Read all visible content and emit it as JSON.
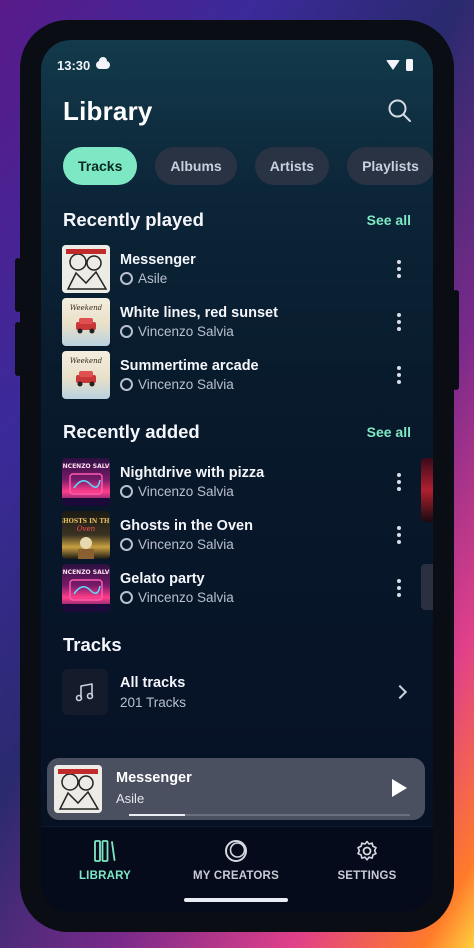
{
  "status_bar": {
    "time": "13:30"
  },
  "header": {
    "title": "Library"
  },
  "chips": [
    {
      "label": "Tracks",
      "active": true
    },
    {
      "label": "Albums"
    },
    {
      "label": "Artists"
    },
    {
      "label": "Playlists"
    }
  ],
  "recently_played": {
    "title": "Recently played",
    "see_all": "See all",
    "items": [
      {
        "name": "Messenger",
        "artist": "Asile"
      },
      {
        "name": "White lines, red sunset",
        "artist": "Vincenzo Salvia"
      },
      {
        "name": "Summertime arcade",
        "artist": "Vincenzo Salvia"
      }
    ]
  },
  "recently_added": {
    "title": "Recently added",
    "see_all": "See all",
    "items": [
      {
        "name": "Nightdrive with pizza",
        "artist": "Vincenzo Salvia"
      },
      {
        "name": "Ghosts in the Oven",
        "artist": "Vincenzo Salvia"
      },
      {
        "name": "Gelato party",
        "artist": "Vincenzo Salvia"
      }
    ]
  },
  "tracks_section": {
    "title": "Tracks",
    "all_tracks_label": "All tracks",
    "count_label": "201 Tracks"
  },
  "now_playing": {
    "title": "Messenger",
    "artist": "Asile",
    "progress": 0.2
  },
  "bottom_nav": [
    {
      "label": "LIBRARY",
      "icon": "library-icon",
      "active": true
    },
    {
      "label": "MY CREATORS",
      "icon": "creators-icon"
    },
    {
      "label": "SETTINGS",
      "icon": "gear-icon"
    }
  ],
  "colors": {
    "accent": "#7ee8c4",
    "chip_bg": "#2a3344",
    "nav_bg": "#050b1a"
  }
}
